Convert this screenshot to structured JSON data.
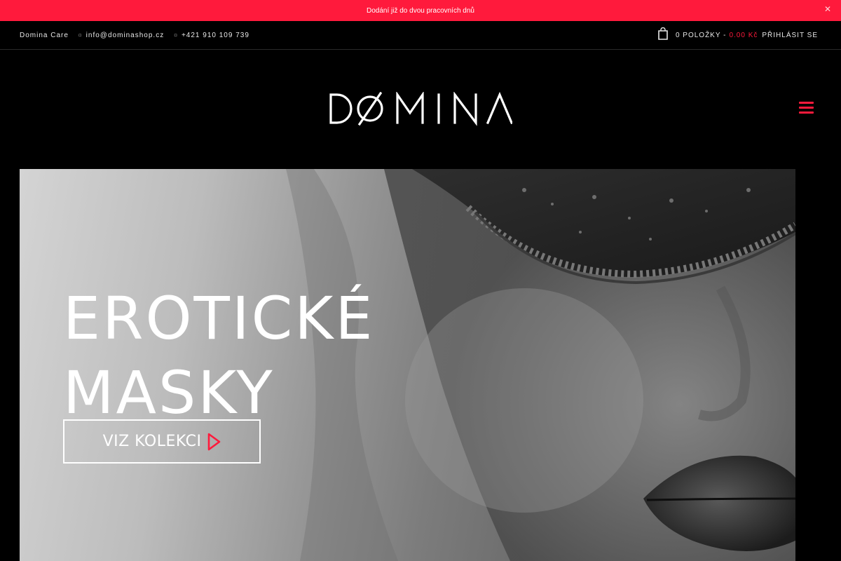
{
  "notice": {
    "text": "Dodání již do dvou pracovních dnů",
    "close_icon": "close-icon"
  },
  "topbar": {
    "brand_link": "Domina Care",
    "email": "info@dominashop.cz",
    "phone": "+421 910 109 739",
    "email_icon": "envelope-icon",
    "phone_icon": "phone-icon",
    "cart": {
      "icon": "shopping-bag-icon",
      "count_text": "0 POLOŽKY -",
      "price": "0.00 Kč"
    },
    "login": "PŘIHLÁSIT SE"
  },
  "header": {
    "logo_text": "DOMINA",
    "menu_icon": "hamburger-menu-icon"
  },
  "hero": {
    "title_line1": "EROTICKÉ",
    "title_line2": "MASKY",
    "button_label": "VIZ KOLEKCI",
    "button_icon": "play-icon"
  },
  "colors": {
    "accent": "#ff1a3c",
    "background": "#000000",
    "text": "#ffffff"
  }
}
